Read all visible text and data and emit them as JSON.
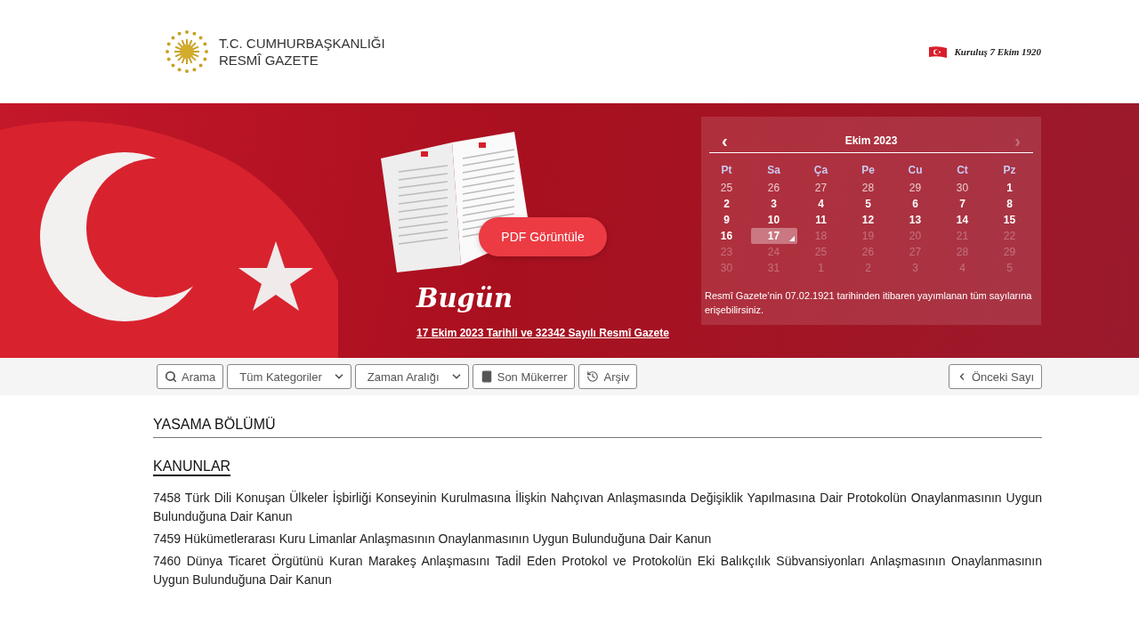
{
  "header": {
    "title_line1": "T.C. CUMHURBAŞKANLIĞI",
    "title_line2": "RESMÎ GAZETE",
    "motto": "Kuruluş 7 Ekim 1920"
  },
  "hero": {
    "pdf_button": "PDF Görüntüle",
    "today_title": "Bugün",
    "today_link": "17 Ekim 2023 Tarihli ve 32342 Sayılı Resmî Gazete",
    "calendar": {
      "month": "Ekim 2023",
      "prev": {
        "label": "‹",
        "disabled": false
      },
      "next": {
        "label": "›",
        "disabled": true
      },
      "weekdays": [
        "Pt",
        "Sa",
        "Ça",
        "Pe",
        "Cu",
        "Ct",
        "Pz"
      ],
      "weeks": [
        [
          {
            "day": "25",
            "kind": "outside",
            "selected": false
          },
          {
            "day": "26",
            "kind": "outside",
            "selected": false
          },
          {
            "day": "27",
            "kind": "outside",
            "selected": false
          },
          {
            "day": "28",
            "kind": "outside",
            "selected": false
          },
          {
            "day": "29",
            "kind": "outside",
            "selected": false
          },
          {
            "day": "30",
            "kind": "outside",
            "selected": false
          },
          {
            "day": "1",
            "kind": "published",
            "selected": false
          }
        ],
        [
          {
            "day": "2",
            "kind": "published",
            "selected": false
          },
          {
            "day": "3",
            "kind": "published",
            "selected": false
          },
          {
            "day": "4",
            "kind": "published",
            "selected": false
          },
          {
            "day": "5",
            "kind": "published",
            "selected": false
          },
          {
            "day": "6",
            "kind": "published",
            "selected": false
          },
          {
            "day": "7",
            "kind": "published",
            "selected": false
          },
          {
            "day": "8",
            "kind": "published",
            "selected": false
          }
        ],
        [
          {
            "day": "9",
            "kind": "published",
            "selected": false
          },
          {
            "day": "10",
            "kind": "published",
            "selected": false
          },
          {
            "day": "11",
            "kind": "published",
            "selected": false
          },
          {
            "day": "12",
            "kind": "published",
            "selected": false
          },
          {
            "day": "13",
            "kind": "published",
            "selected": false
          },
          {
            "day": "14",
            "kind": "published",
            "selected": false
          },
          {
            "day": "15",
            "kind": "published",
            "selected": false
          }
        ],
        [
          {
            "day": "16",
            "kind": "published",
            "selected": false
          },
          {
            "day": "17",
            "kind": "published",
            "selected": true
          },
          {
            "day": "18",
            "kind": "upcoming",
            "selected": false
          },
          {
            "day": "19",
            "kind": "upcoming",
            "selected": false
          },
          {
            "day": "20",
            "kind": "upcoming",
            "selected": false
          },
          {
            "day": "21",
            "kind": "upcoming",
            "selected": false
          },
          {
            "day": "22",
            "kind": "upcoming",
            "selected": false
          }
        ],
        [
          {
            "day": "23",
            "kind": "upcoming",
            "selected": false
          },
          {
            "day": "24",
            "kind": "upcoming",
            "selected": false
          },
          {
            "day": "25",
            "kind": "upcoming",
            "selected": false
          },
          {
            "day": "26",
            "kind": "upcoming",
            "selected": false
          },
          {
            "day": "27",
            "kind": "upcoming",
            "selected": false
          },
          {
            "day": "28",
            "kind": "upcoming",
            "selected": false
          },
          {
            "day": "29",
            "kind": "upcoming",
            "selected": false
          }
        ],
        [
          {
            "day": "30",
            "kind": "upcoming",
            "selected": false
          },
          {
            "day": "31",
            "kind": "upcoming",
            "selected": false
          },
          {
            "day": "1",
            "kind": "upcoming",
            "selected": false
          },
          {
            "day": "2",
            "kind": "upcoming",
            "selected": false
          },
          {
            "day": "3",
            "kind": "upcoming",
            "selected": false
          },
          {
            "day": "4",
            "kind": "upcoming",
            "selected": false
          },
          {
            "day": "5",
            "kind": "upcoming",
            "selected": false
          }
        ]
      ],
      "note": "Resmî Gazete’nin 07.02.1921 tarihinden itibaren yayımlanan tüm sayılarına erişebilirsiniz."
    }
  },
  "toolbar": {
    "items": [
      {
        "kind": "search",
        "label": "Arama"
      },
      {
        "kind": "select",
        "label": "Tüm Kategoriler"
      },
      {
        "kind": "select",
        "label": "Zaman Aralığı"
      },
      {
        "kind": "book",
        "label": "Son Mükerrer"
      },
      {
        "kind": "history",
        "label": "Arşiv"
      }
    ],
    "previous_button": "Önceki Sayı"
  },
  "content": {
    "section_title": "YASAMA BÖLÜMÜ",
    "subsections": [
      {
        "title": "KANUNLAR",
        "items": [
          "7458 Türk Dili Konuşan Ülkeler İşbirliği Konseyinin Kurulmasına İlişkin Nahçıvan Anlaşmasında Değişiklik Yapılmasına Dair Protokolün Onaylanmasının Uygun Bulunduğuna Dair Kanun",
          "7459 Hükümetlerarası Kuru Limanlar Anlaşmasının Onaylanmasının Uygun Bulunduğuna Dair Kanun",
          "7460 Dünya Ticaret Örgütünü Kuran Marakeş Anlaşmasını Tadil Eden Protokol ve Protokolün Eki Balıkçılık Sübvansiyonları Anlaşmasının Onaylanmasının Uygun Bulunduğuna Dair Kanun"
        ]
      }
    ]
  }
}
